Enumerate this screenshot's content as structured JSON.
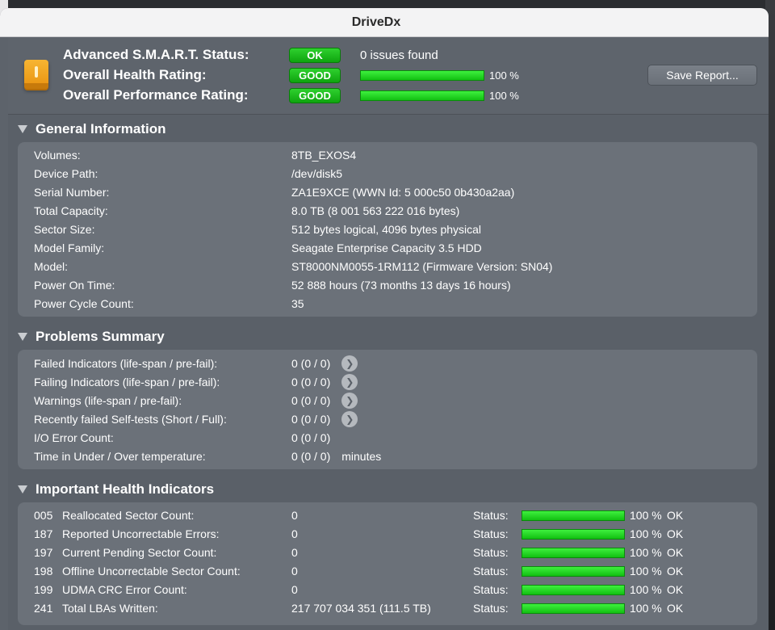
{
  "window": {
    "title": "DriveDx"
  },
  "status": {
    "rows": [
      {
        "label": "Advanced S.M.A.R.T. Status:",
        "badge": "OK",
        "text": "0 issues found"
      },
      {
        "label": "Overall Health Rating:",
        "badge": "GOOD",
        "percent_label": "100 %",
        "percent": 100
      },
      {
        "label": "Overall Performance Rating:",
        "badge": "GOOD",
        "percent_label": "100 %",
        "percent": 100
      }
    ],
    "save_button": "Save Report...",
    "colors": {
      "good": "#1ec41e",
      "panel": "#6b7179",
      "background": "#5a6068"
    },
    "icon": "external-drive-icon"
  },
  "general": {
    "title": "General Information",
    "rows": [
      {
        "label": "Volumes:",
        "value": "8TB_EXOS4"
      },
      {
        "label": "Device Path:",
        "value": "/dev/disk5"
      },
      {
        "label": "Serial Number:",
        "value": "ZA1E9XCE (WWN Id: 5 000c50 0b430a2aa)"
      },
      {
        "label": "Total Capacity:",
        "value": "8.0 TB (8 001 563 222 016 bytes)"
      },
      {
        "label": "Sector Size:",
        "value": "512 bytes logical, 4096 bytes physical"
      },
      {
        "label": "Model Family:",
        "value": "Seagate Enterprise Capacity 3.5 HDD"
      },
      {
        "label": "Model:",
        "value": "ST8000NM0055-1RM112  (Firmware Version: SN04)"
      },
      {
        "label": "Power On Time:",
        "value": "52 888 hours (73 months 13 days 16 hours)"
      },
      {
        "label": "Power Cycle Count:",
        "value": "35"
      }
    ]
  },
  "problems": {
    "title": "Problems Summary",
    "rows": [
      {
        "label": "Failed Indicators (life-span / pre-fail):",
        "value": "0 (0 / 0)",
        "arrow": true
      },
      {
        "label": "Failing Indicators (life-span / pre-fail):",
        "value": "0 (0 / 0)",
        "arrow": true
      },
      {
        "label": "Warnings (life-span / pre-fail):",
        "value": "0 (0 / 0)",
        "arrow": true
      },
      {
        "label": "Recently failed Self-tests (Short / Full):",
        "value": "0 (0 / 0)",
        "arrow": true
      },
      {
        "label": "I/O Error Count:",
        "value": "0 (0 / 0)"
      },
      {
        "label": "Time in Under / Over temperature:",
        "value": "0 (0 / 0)",
        "unit": "minutes"
      }
    ]
  },
  "health": {
    "title": "Important Health Indicators",
    "status_label": "Status:",
    "rows": [
      {
        "id": "005",
        "label": "Reallocated Sector Count:",
        "value": "0",
        "percent_label": "100 %",
        "percent": 100,
        "state": "OK"
      },
      {
        "id": "187",
        "label": "Reported Uncorrectable Errors:",
        "value": "0",
        "percent_label": "100 %",
        "percent": 100,
        "state": "OK"
      },
      {
        "id": "197",
        "label": "Current Pending Sector Count:",
        "value": "0",
        "percent_label": "100 %",
        "percent": 100,
        "state": "OK"
      },
      {
        "id": "198",
        "label": "Offline Uncorrectable Sector Count:",
        "value": "0",
        "percent_label": "100 %",
        "percent": 100,
        "state": "OK"
      },
      {
        "id": "199",
        "label": "UDMA CRC Error Count:",
        "value": "0",
        "percent_label": "100 %",
        "percent": 100,
        "state": "OK"
      },
      {
        "id": "241",
        "label": "Total LBAs Written:",
        "value": "217 707 034 351 (111.5 TB)",
        "percent_label": "100 %",
        "percent": 100,
        "state": "OK"
      }
    ]
  }
}
